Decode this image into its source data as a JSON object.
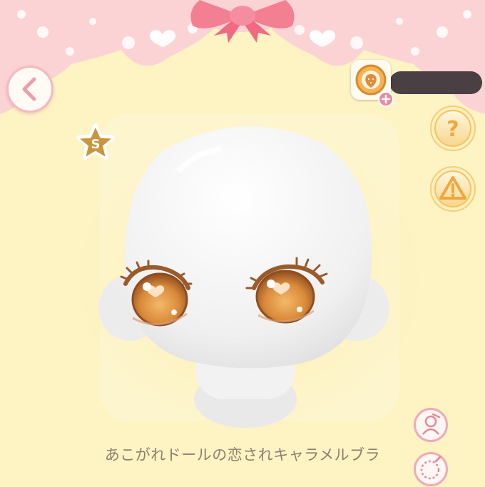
{
  "item": {
    "name": "あこがれドールの恋されキャラメルブラ"
  },
  "header": {
    "currency_value": ""
  },
  "buttons": {
    "back": "back-arrow-icon",
    "help": "question-icon",
    "warning": "warning-icon",
    "rarity": "S",
    "tool1": "character-icon",
    "tool2": "color-picker-icon"
  },
  "colors": {
    "background": "#fdf3c3",
    "scallop": "#fbd3d5",
    "ribbon": "#f37f93",
    "accent_pink": "#f2a9b6",
    "gold": "#f7c25c",
    "text": "#8c7e6e",
    "eye": "#d98a3a"
  }
}
